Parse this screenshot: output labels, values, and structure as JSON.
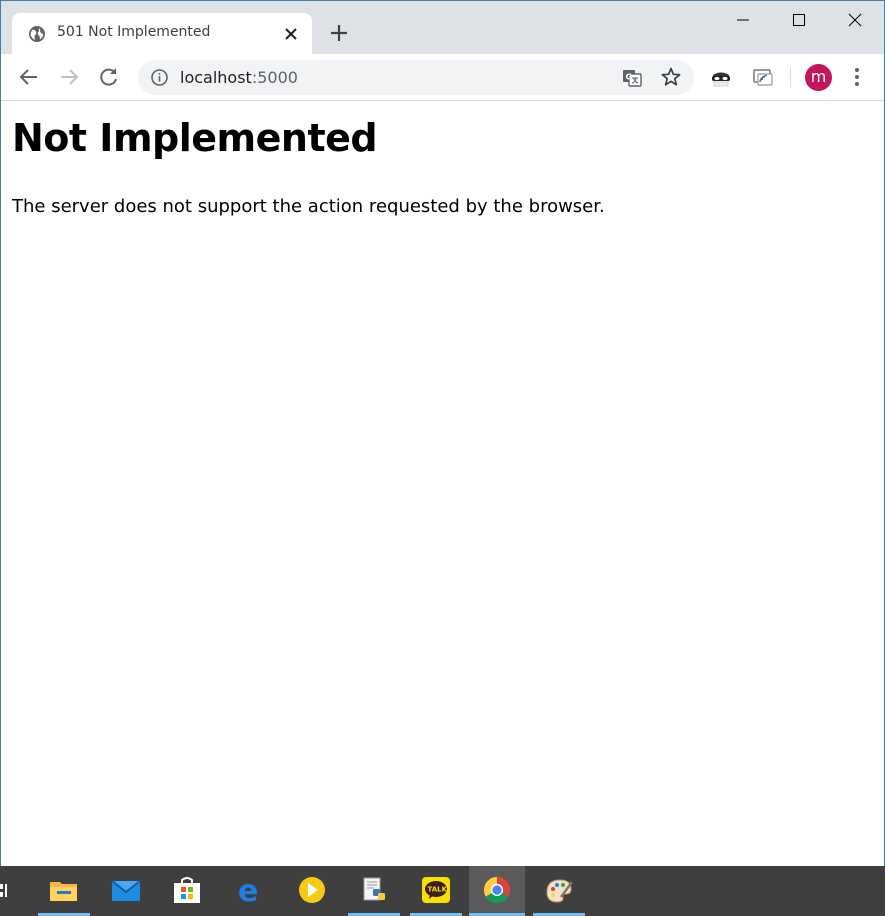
{
  "browser": {
    "tab": {
      "title": "501 Not Implemented",
      "favicon": "globe-icon"
    },
    "url": {
      "host": "localhost",
      "port": ":5000"
    },
    "profile_initial": "m",
    "accent": "#c2185b"
  },
  "page": {
    "heading": "Not Implemented",
    "message": "The server does not support the action requested by the browser."
  },
  "taskbar": {
    "apps": [
      {
        "name": "file-explorer-icon",
        "running": true
      },
      {
        "name": "mail-icon",
        "running": false
      },
      {
        "name": "store-icon",
        "running": false
      },
      {
        "name": "edge-icon",
        "running": false
      },
      {
        "name": "media-player-icon",
        "running": false
      },
      {
        "name": "python-icon",
        "running": true
      },
      {
        "name": "kakaotalk-icon",
        "label": "TALK",
        "running": true
      },
      {
        "name": "chrome-icon",
        "running": true,
        "active": true
      },
      {
        "name": "paint-icon",
        "running": true
      }
    ]
  }
}
